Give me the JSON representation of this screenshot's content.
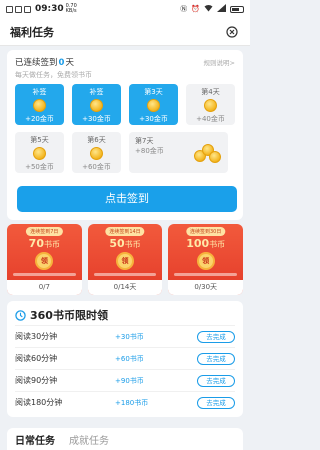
{
  "status": {
    "time": "09:30",
    "speed": "0.70 KB/s"
  },
  "nav": {
    "title": "福利任务"
  },
  "signin": {
    "prefix": "已连续签到",
    "days": "0",
    "suffix": "天",
    "rules": "规则说明>",
    "subtitle": "每天做任务，免费领书币",
    "items": [
      {
        "label": "补签",
        "value": "+20金币",
        "state": "done"
      },
      {
        "label": "补签",
        "value": "+30金币",
        "state": "done"
      },
      {
        "label": "第3天",
        "value": "+30金币",
        "state": "done"
      },
      {
        "label": "第4天",
        "value": "+40金币",
        "state": "todo"
      },
      {
        "label": "第5天",
        "value": "+50金币",
        "state": "todo"
      },
      {
        "label": "第6天",
        "value": "+60金币",
        "state": "todo"
      }
    ],
    "day7": {
      "label": "第7天",
      "value": "+80金币"
    },
    "button": "点击签到"
  },
  "rewards": [
    {
      "tag": "连续签到7日",
      "amount": "70",
      "unit": "书币",
      "btn": "领",
      "progress": "0/7",
      "fraction": 0
    },
    {
      "tag": "连续签到14日",
      "amount": "50",
      "unit": "书币",
      "btn": "领",
      "progress": "0/14天",
      "fraction": 0
    },
    {
      "tag": "连续签到30日",
      "amount": "100",
      "unit": "书币",
      "btn": "领",
      "progress": "0/30天",
      "fraction": 0
    }
  ],
  "timed": {
    "title": "360书币限时领",
    "rows": [
      {
        "name": "阅读30分钟",
        "reward": "+30书币",
        "action": "去完成"
      },
      {
        "name": "阅读60分钟",
        "reward": "+60书币",
        "action": "去完成"
      },
      {
        "name": "阅读90分钟",
        "reward": "+90书币",
        "action": "去完成"
      },
      {
        "name": "阅读180分钟",
        "reward": "+180书币",
        "action": "去完成"
      }
    ]
  },
  "tabs": [
    {
      "label": "日常任务",
      "active": true
    },
    {
      "label": "成就任务",
      "active": false
    }
  ],
  "colors": {
    "accent": "#1aa0ea",
    "red": "#e6442e",
    "coin": "#f3b51f"
  }
}
